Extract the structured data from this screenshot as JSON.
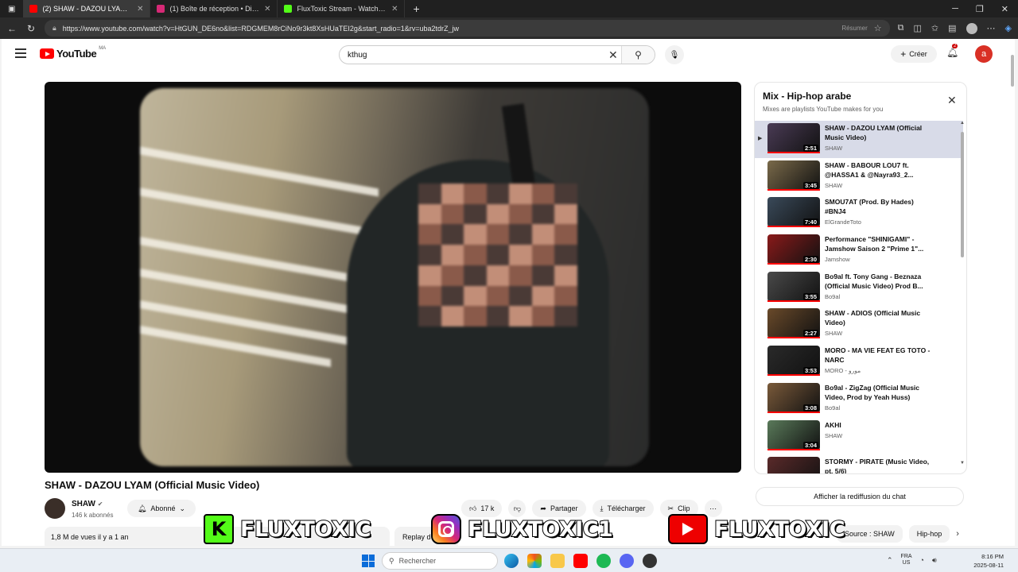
{
  "browser": {
    "tabs": [
      {
        "label": "(2) SHAW - DAZOU LYAM (O",
        "color": "#ff0000",
        "active": true
      },
      {
        "label": "(1) Boîte de réception • Direct",
        "color": "#d62976",
        "active": false
      },
      {
        "label": "FluxToxic Stream - Watch Live on",
        "color": "#53fc18",
        "active": false
      }
    ],
    "url": "https://www.youtube.com/watch?v=HtGUN_DE6no&list=RDGMEM8rCiNo9r3kt8XsHUaTEI2g&start_radio=1&rv=uba2tdrZ_jw",
    "resume_label": "Résumer"
  },
  "youtube": {
    "logo_text": "YouTube",
    "country_code": "MA",
    "search_query": "kthug",
    "create_label": "Créer",
    "notif_count": "2",
    "avatar_letter": "a"
  },
  "video": {
    "title": "SHAW - DAZOU LYAM (Official Music Video)",
    "channel": "SHAW",
    "subscribers": "146 k abonnés",
    "subscribed_label": "Abonné",
    "likes": "17 k",
    "share_label": "Partager",
    "download_label": "Télécharger",
    "clip_label": "Clip",
    "views": "1,8 M de vues  il y a 1 an",
    "replay_label": "Replay d"
  },
  "playlist": {
    "title": "Mix - Hip-hop arabe",
    "subtitle": "Mixes are playlists YouTube makes for you",
    "items": [
      {
        "title": "SHAW - DAZOU LYAM (Official Music Video)",
        "channel": "SHAW",
        "duration": "2:51",
        "thumb": "#4a3b55"
      },
      {
        "title": "SHAW - BABOUR LOU7 ft. @HASSA1 & @Nayra93_2...",
        "channel": "SHAW",
        "duration": "3:45",
        "thumb": "#7a6a4a"
      },
      {
        "title": "SMOU7AT (Prod. By Hades) #BNJ4",
        "channel": "ElGrandeToto",
        "duration": "7:40",
        "thumb": "#3a4a5a"
      },
      {
        "title": "Performance \"SHINIGAMI\" - Jamshow Saison 2 \"Prime 1\"...",
        "channel": "Jamshow",
        "duration": "2:30",
        "thumb": "#8a1a1a"
      },
      {
        "title": "Bo9al ft. Tony Gang - Beznaza (Official Music Video) Prod B...",
        "channel": "Bo9al",
        "duration": "3:55",
        "thumb": "#4a4a4a"
      },
      {
        "title": "SHAW - ADIOS (Official Music Video)",
        "channel": "SHAW",
        "duration": "2:27",
        "thumb": "#6a4a2a"
      },
      {
        "title": "MORO - MA VIE FEAT EG TOTO - NARC",
        "channel": "MORO - مورو",
        "duration": "3:53",
        "thumb": "#2a2a2a"
      },
      {
        "title": "Bo9al - ZigZag (Official Music Video, Prod by Yeah Huss)",
        "channel": "Bo9al",
        "duration": "3:08",
        "thumb": "#7a5a3a"
      },
      {
        "title": "AKHI",
        "channel": "SHAW",
        "duration": "3:04",
        "thumb": "#5a7a5a"
      },
      {
        "title": "STORMY - PIRATE (Music Video, pt. 5/6)",
        "channel": "",
        "duration": "",
        "thumb": "#5a2a2a"
      }
    ]
  },
  "chat_replay_label": "Afficher la rediffusion du chat",
  "chips": [
    "Source : SHAW",
    "Hip-hop"
  ],
  "overlay": {
    "kick_text": "FLUXTOXIC",
    "insta_text": "FLUXTOXIC1",
    "youtube_text": "FLUXTOXIC"
  },
  "taskbar": {
    "search_placeholder": "Rechercher",
    "lang": "FRA\nUS",
    "time": "8:16 PM",
    "date": "2025-08-11"
  }
}
